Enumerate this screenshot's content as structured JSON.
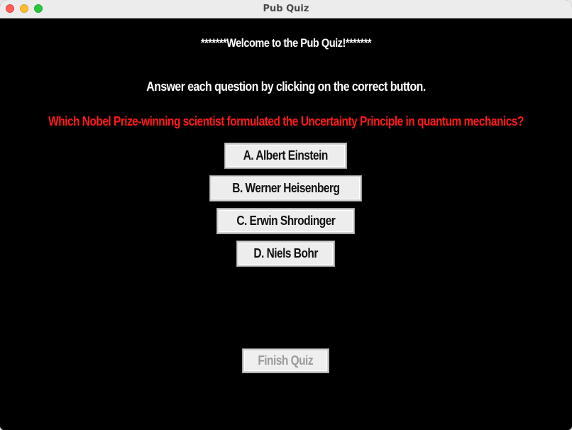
{
  "window": {
    "title": "Pub Quiz"
  },
  "quiz": {
    "welcome": "*******Welcome to the Pub Quiz!*******",
    "instruction": "Answer each question by clicking on the correct button.",
    "question": "Which Nobel Prize-winning scientist formulated the Uncertainty Principle in quantum mechanics?",
    "answers": [
      "A. Albert Einstein",
      "B. Werner Heisenberg",
      "C. Erwin Shrodinger",
      "D. Niels Bohr"
    ],
    "finish_label": "Finish Quiz",
    "finish_enabled": false
  },
  "colors": {
    "background": "#000000",
    "question_text": "#ff1a1a",
    "heading_text": "#ffffff",
    "disabled_text": "#9b9b9b"
  }
}
